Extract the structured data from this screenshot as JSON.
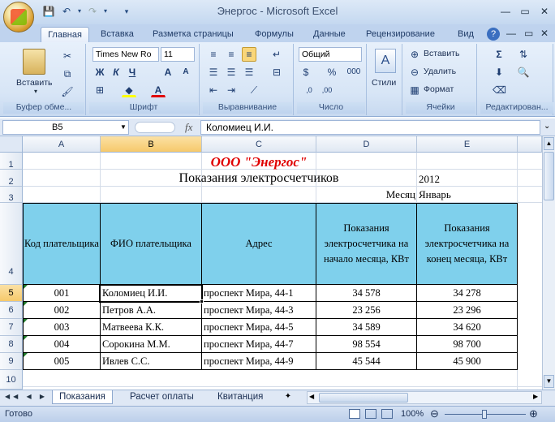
{
  "window": {
    "title": "Энергос - Microsoft Excel"
  },
  "tabs": [
    "Главная",
    "Вставка",
    "Разметка страницы",
    "Формулы",
    "Данные",
    "Рецензирование",
    "Вид"
  ],
  "ribbon": {
    "paste_label": "Вставить",
    "font_name": "Times New Ro",
    "font_size": "11",
    "number_format": "Общий",
    "styles_label": "Стили",
    "insert_label": "Вставить",
    "delete_label": "Удалить",
    "format_label": "Формат",
    "groups": [
      "Буфер обме...",
      "Шрифт",
      "Выравнивание",
      "Число",
      "Ячейки",
      "Редактирован..."
    ],
    "bold": "Ж",
    "italic": "К",
    "underline": "Ч",
    "grow_font": "A",
    "shrink_font": "A",
    "percent": "%",
    "thousands": "000",
    "sigma": "Σ"
  },
  "formula_bar": {
    "name_box": "B5",
    "fx": "fx",
    "formula": "Коломиец И.И."
  },
  "columns": [
    "A",
    "B",
    "C",
    "D",
    "E"
  ],
  "rows": [
    "1",
    "2",
    "3",
    "4",
    "5",
    "6",
    "7",
    "8",
    "9",
    "10"
  ],
  "sheet": {
    "company": "ООО \"Энергос\"",
    "subtitle": "Показания электросчетчиков",
    "year": "2012",
    "month_label": "Месяц",
    "month": "Январь",
    "headers": [
      "Код плательщика",
      "ФИО плательщика",
      "Адрес",
      "Показания электросчетчика на начало месяца, КВт",
      "Показания электросчетчика на конец месяца, КВт"
    ],
    "records": [
      [
        "001",
        "Коломиец И.И.",
        "проспект Мира, 44-1",
        "34 578",
        "34 278"
      ],
      [
        "002",
        "Петров А.А.",
        "проспект Мира, 44-3",
        "23 256",
        "23 296"
      ],
      [
        "003",
        "Матвеева К.К.",
        "проспект Мира, 44-5",
        "34 589",
        "34 620"
      ],
      [
        "004",
        "Сорокина М.М.",
        "проспект Мира, 44-7",
        "98 554",
        "98 700"
      ],
      [
        "005",
        "Ивлев С.С.",
        "проспект Мира, 44-9",
        "45 544",
        "45 900"
      ]
    ]
  },
  "sheet_tabs": [
    "Показания",
    "Расчет оплаты",
    "Квитанция"
  ],
  "status": {
    "ready": "Готово",
    "zoom": "100%"
  }
}
